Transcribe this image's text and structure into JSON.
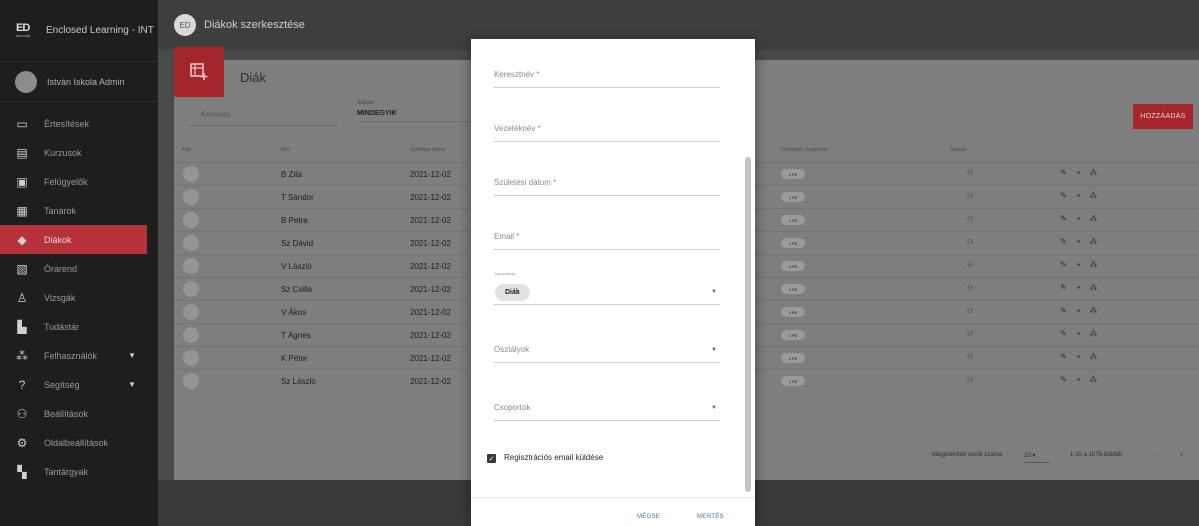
{
  "app": {
    "title": "Enclosed Learning - INT",
    "logo_main": "ED",
    "logo_sub": "learning"
  },
  "user": {
    "name": "István Iskola Admin"
  },
  "sidebar": {
    "items": [
      {
        "label": "Értesítések",
        "icon": "message-icon",
        "glyph": "▭"
      },
      {
        "label": "Kurzusok",
        "icon": "courses-icon",
        "glyph": "▤"
      },
      {
        "label": "Felügyelők",
        "icon": "supervisor-icon",
        "glyph": "▣"
      },
      {
        "label": "Tanárok",
        "icon": "teacher-icon",
        "glyph": "▦"
      },
      {
        "label": "Diákok",
        "icon": "graduation-cap-icon",
        "glyph": "◆"
      },
      {
        "label": "Órarend",
        "icon": "timetable-icon",
        "glyph": "▧"
      },
      {
        "label": "Vizsgák",
        "icon": "exam-icon",
        "glyph": "♙"
      },
      {
        "label": "Tudástár",
        "icon": "library-icon",
        "glyph": "▙"
      },
      {
        "label": "Felhasználók",
        "icon": "users-icon",
        "glyph": "⁂"
      },
      {
        "label": "Segítség",
        "icon": "help-icon",
        "glyph": "?"
      },
      {
        "label": "Beállítások",
        "icon": "settings-user-icon",
        "glyph": "⚇"
      },
      {
        "label": "Oldalbeállítások",
        "icon": "site-settings-icon",
        "glyph": "⚙"
      },
      {
        "label": "Tantárgyak",
        "icon": "subjects-icon",
        "glyph": "▚"
      }
    ],
    "active": "Diákok"
  },
  "header": {
    "title": "Diákok szerkesztése",
    "icon_text": "ED"
  },
  "card": {
    "title": "Diák",
    "search_placeholder": "Keresés",
    "status_label": "Státusz",
    "status_value": "MINDEGYIK",
    "add_label": "HOZZÁADÁS"
  },
  "table": {
    "headers": {
      "pic": "Kép",
      "name": "Név",
      "birth": "Születési dátum",
      "classes": "Osztályok, csoportok",
      "status": "Státusz"
    },
    "rows": [
      {
        "name": "B Zita",
        "date": "2021-12-02",
        "chip": "1 FS"
      },
      {
        "name": "T Sándor",
        "date": "2021-12-02",
        "chip": "1 FS"
      },
      {
        "name": "B Petra",
        "date": "2021-12-02",
        "chip": "1 FS"
      },
      {
        "name": "Sz Dávid",
        "date": "2021-12-02",
        "chip": "1 FS"
      },
      {
        "name": "V László",
        "date": "2021-12-02",
        "chip": "1 FS"
      },
      {
        "name": "Sz Csilla",
        "date": "2021-12-02",
        "chip": "1 FS"
      },
      {
        "name": "V Ákos",
        "date": "2021-12-02",
        "chip": "1 FS"
      },
      {
        "name": "T Ágnes",
        "date": "2021-12-02",
        "chip": "1 FS"
      },
      {
        "name": "K Péter",
        "date": "2021-12-02",
        "chip": "1 FS"
      },
      {
        "name": "Sz László",
        "date": "2021-12-02",
        "chip": "1 FS"
      }
    ],
    "pagination": {
      "rows_label": "Megjelenített sorok száma",
      "rows_value": "10",
      "range": "1-10 a 1078-ből/ből"
    }
  },
  "dialog": {
    "first_name": "Keresztnév *",
    "last_name": "Vezetéknév *",
    "birth_date": "Születési dátum *",
    "email": "Email *",
    "role_label": "Jogosultság",
    "role_value": "Diák",
    "classes": "Osztályok",
    "groups": "Csoportok",
    "send_email_label": "Regisztrációs email küldése",
    "cancel": "MÉGSE",
    "save": "MENTÉS"
  },
  "colors": {
    "accent": "#a3262c",
    "link": "#3f6fa6"
  }
}
